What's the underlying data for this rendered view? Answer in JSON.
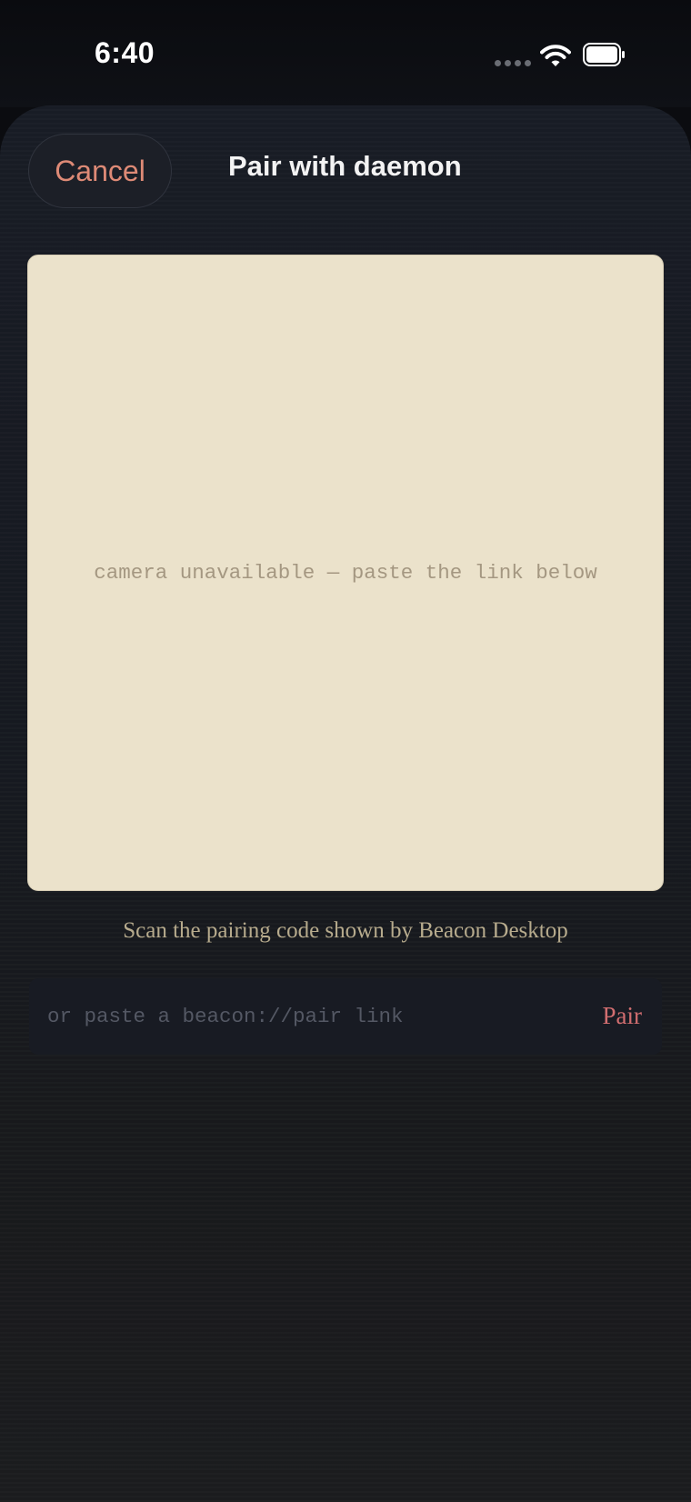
{
  "status_bar": {
    "time": "6:40",
    "icons": [
      "cellular-signal-icon",
      "wifi-icon",
      "battery-icon"
    ]
  },
  "header": {
    "cancel_label": "Cancel",
    "title": "Pair with daemon"
  },
  "camera": {
    "message": "camera unavailable — paste the link below"
  },
  "scan_hint": "Scan the pairing code shown by Beacon Desktop",
  "paste": {
    "placeholder": "or paste a beacon://pair link",
    "value": "",
    "pair_label": "Pair"
  },
  "colors": {
    "accent": "#de8a76",
    "pair_accent": "#d26e70",
    "camera_background": "#ebe2cb",
    "sheet_background": "#161920"
  }
}
